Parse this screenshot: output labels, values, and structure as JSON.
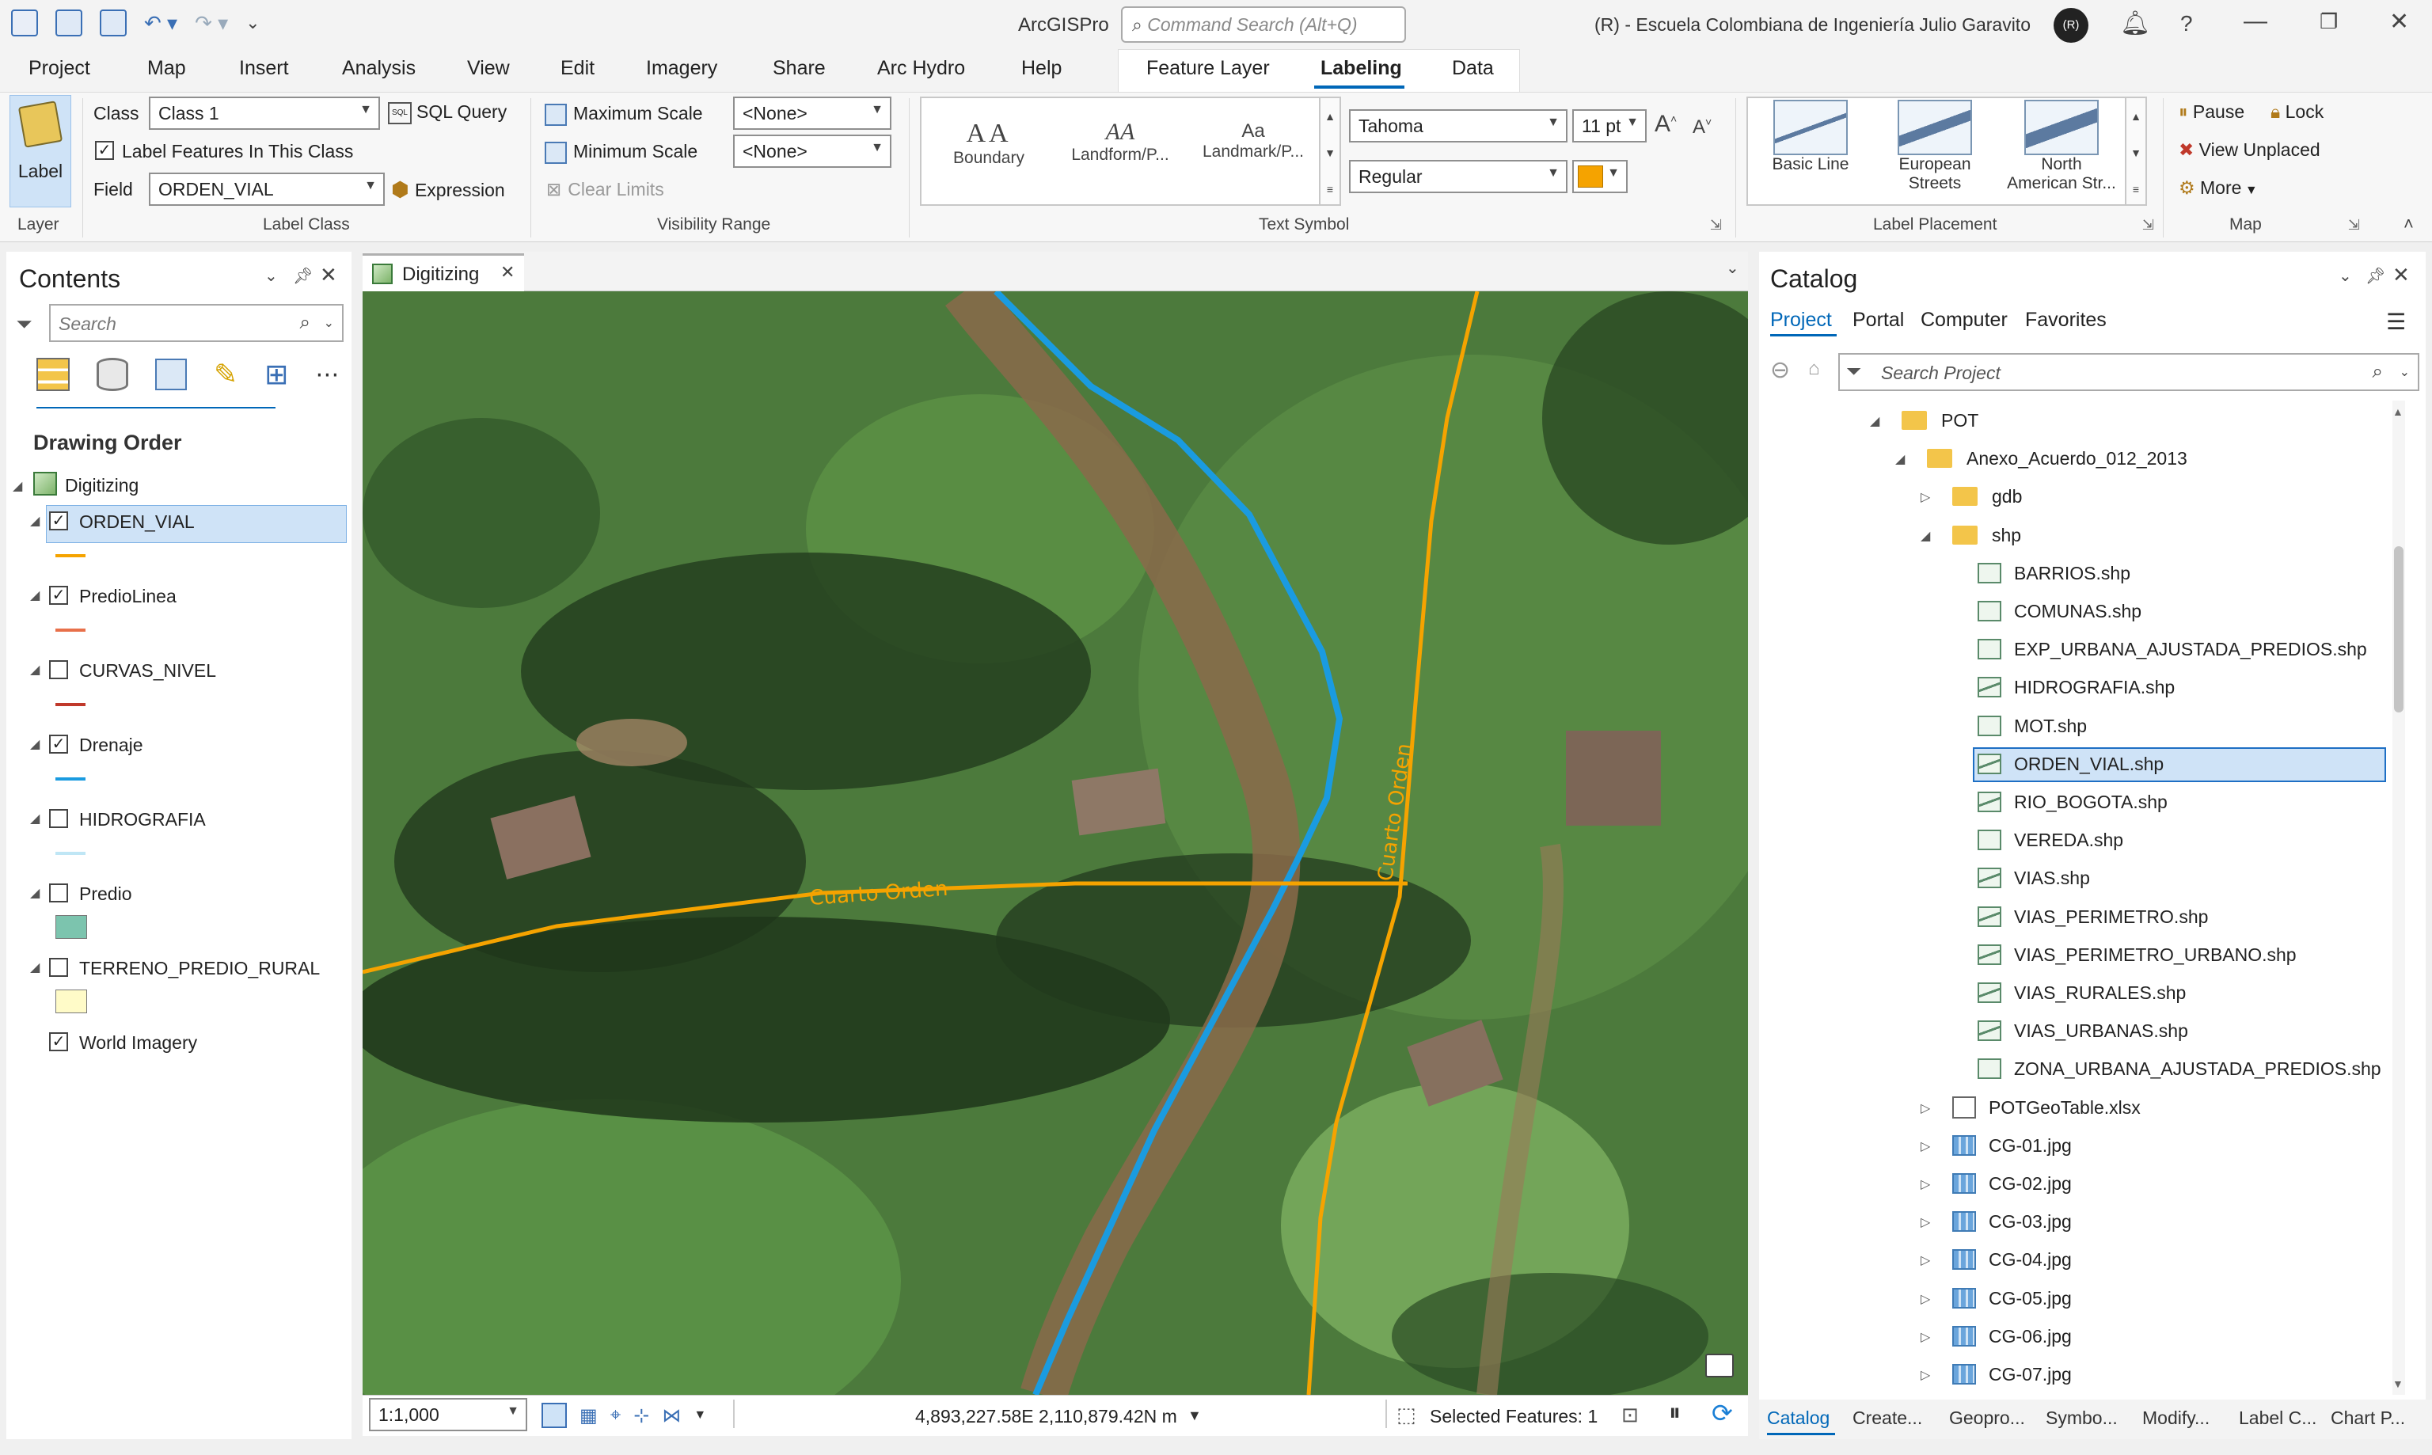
{
  "app": {
    "title": "ArcGISPro",
    "command_search_placeholder": "Command Search (Alt+Q)",
    "org": "(R) - Escuela Colombiana de Ingeniería Julio Garavito",
    "avatar_text": "(R)"
  },
  "menu": {
    "tabs": [
      "Project",
      "Map",
      "Insert",
      "Analysis",
      "View",
      "Edit",
      "Imagery",
      "Share",
      "Arc Hydro",
      "Help"
    ],
    "context_tabs": [
      "Feature Layer",
      "Labeling",
      "Data"
    ],
    "active_context_tab": "Labeling"
  },
  "ribbon": {
    "layer": {
      "label_button": "Label",
      "group": "Layer"
    },
    "label_class": {
      "class_label": "Class",
      "class_value": "Class 1",
      "sql_query": "SQL Query",
      "label_features": "Label Features In This Class",
      "label_features_checked": true,
      "field_label": "Field",
      "field_value": "ORDEN_VIAL",
      "expression": "Expression",
      "group": "Label Class"
    },
    "visibility_range": {
      "max_scale": "Maximum Scale",
      "max_value": "<None>",
      "min_scale": "Minimum Scale",
      "min_value": "<None>",
      "clear_limits": "Clear Limits",
      "group": "Visibility Range"
    },
    "text_symbol": {
      "gallery": [
        {
          "glyph": "AA",
          "label": "Boundary"
        },
        {
          "glyph": "AA",
          "label": "Landform/P..."
        },
        {
          "glyph": "Aa",
          "label": "Landmark/P..."
        }
      ],
      "font": "Tahoma",
      "size": "11 pt",
      "style": "Regular",
      "color": "#f5a300",
      "grow": "A",
      "shrink": "A",
      "group": "Text Symbol"
    },
    "label_placement": {
      "gallery": [
        {
          "label": "Basic Line"
        },
        {
          "label": "European Streets"
        },
        {
          "label": "North American Str..."
        }
      ],
      "group": "Label Placement"
    },
    "map": {
      "pause": "Pause",
      "lock": "Lock",
      "view_unplaced": "View Unplaced",
      "more": "More",
      "group": "Map"
    }
  },
  "contents": {
    "title": "Contents",
    "search_placeholder": "Search",
    "section": "Drawing Order",
    "map_name": "Digitizing",
    "layers": [
      {
        "name": "ORDEN_VIAL",
        "checked": true,
        "symbol": "line",
        "color": "#f5a300",
        "selected": true
      },
      {
        "name": "PredioLinea",
        "checked": true,
        "symbol": "line",
        "color": "#e8704a"
      },
      {
        "name": "CURVAS_NIVEL",
        "checked": false,
        "symbol": "line",
        "color": "#c0392b"
      },
      {
        "name": "Drenaje",
        "checked": true,
        "symbol": "line",
        "color": "#1a9be0"
      },
      {
        "name": "HIDROGRAFIA",
        "checked": false,
        "symbol": "line",
        "color": "#bfe6f5"
      },
      {
        "name": "Predio",
        "checked": false,
        "symbol": "fill",
        "color": "#7cc4ae"
      },
      {
        "name": "TERRENO_PREDIO_RURAL",
        "checked": false,
        "symbol": "fill",
        "color": "#fffbc8"
      },
      {
        "name": "World Imagery",
        "checked": true,
        "symbol": "none",
        "color": ""
      }
    ]
  },
  "map_view": {
    "tab": "Digitizing",
    "labels": [
      "Cuarto Orden",
      "Cuarto Orden"
    ],
    "scale": "1:1,000",
    "coords": "4,893,227.58E 2,110,879.42N m",
    "selected": "Selected Features: 1"
  },
  "catalog": {
    "title": "Catalog",
    "tabs": [
      "Project",
      "Portal",
      "Computer",
      "Favorites"
    ],
    "search_placeholder": "Search Project",
    "tree": [
      {
        "level": 0,
        "type": "folder",
        "name": "POT",
        "expanded": true
      },
      {
        "level": 1,
        "type": "folder",
        "name": "Anexo_Acuerdo_012_2013",
        "expanded": true
      },
      {
        "level": 2,
        "type": "folder",
        "name": "gdb",
        "expanded": false
      },
      {
        "level": 2,
        "type": "folder",
        "name": "shp",
        "expanded": true
      },
      {
        "level": 3,
        "type": "poly",
        "name": "BARRIOS.shp"
      },
      {
        "level": 3,
        "type": "poly",
        "name": "COMUNAS.shp"
      },
      {
        "level": 3,
        "type": "poly",
        "name": "EXP_URBANA_AJUSTADA_PREDIOS.shp"
      },
      {
        "level": 3,
        "type": "line",
        "name": "HIDROGRAFIA.shp"
      },
      {
        "level": 3,
        "type": "poly",
        "name": "MOT.shp"
      },
      {
        "level": 3,
        "type": "line",
        "name": "ORDEN_VIAL.shp",
        "selected": true
      },
      {
        "level": 3,
        "type": "line",
        "name": "RIO_BOGOTA.shp"
      },
      {
        "level": 3,
        "type": "poly",
        "name": "VEREDA.shp"
      },
      {
        "level": 3,
        "type": "line",
        "name": "VIAS.shp"
      },
      {
        "level": 3,
        "type": "line",
        "name": "VIAS_PERIMETRO.shp"
      },
      {
        "level": 3,
        "type": "line",
        "name": "VIAS_PERIMETRO_URBANO.shp"
      },
      {
        "level": 3,
        "type": "line",
        "name": "VIAS_RURALES.shp"
      },
      {
        "level": 3,
        "type": "line",
        "name": "VIAS_URBANAS.shp"
      },
      {
        "level": 3,
        "type": "poly",
        "name": "ZONA_URBANA_AJUSTADA_PREDIOS.shp"
      },
      {
        "level": 2,
        "type": "xls",
        "name": "POTGeoTable.xlsx",
        "expanded": false
      },
      {
        "level": 2,
        "type": "jpg",
        "name": "CG-01.jpg",
        "expanded": false
      },
      {
        "level": 2,
        "type": "jpg",
        "name": "CG-02.jpg",
        "expanded": false
      },
      {
        "level": 2,
        "type": "jpg",
        "name": "CG-03.jpg",
        "expanded": false
      },
      {
        "level": 2,
        "type": "jpg",
        "name": "CG-04.jpg",
        "expanded": false
      },
      {
        "level": 2,
        "type": "jpg",
        "name": "CG-05.jpg",
        "expanded": false
      },
      {
        "level": 2,
        "type": "jpg",
        "name": "CG-06.jpg",
        "expanded": false
      },
      {
        "level": 2,
        "type": "jpg",
        "name": "CG-07.jpg",
        "expanded": false
      }
    ],
    "bottom_tabs": [
      "Catalog",
      "Create...",
      "Geopro...",
      "Symbo...",
      "Modify...",
      "Label C...",
      "Chart P..."
    ]
  },
  "colors": {
    "accent": "#0067b8",
    "selection_bg": "#cfe3f7",
    "road": "#f5a300",
    "drain": "#1a9be0"
  }
}
